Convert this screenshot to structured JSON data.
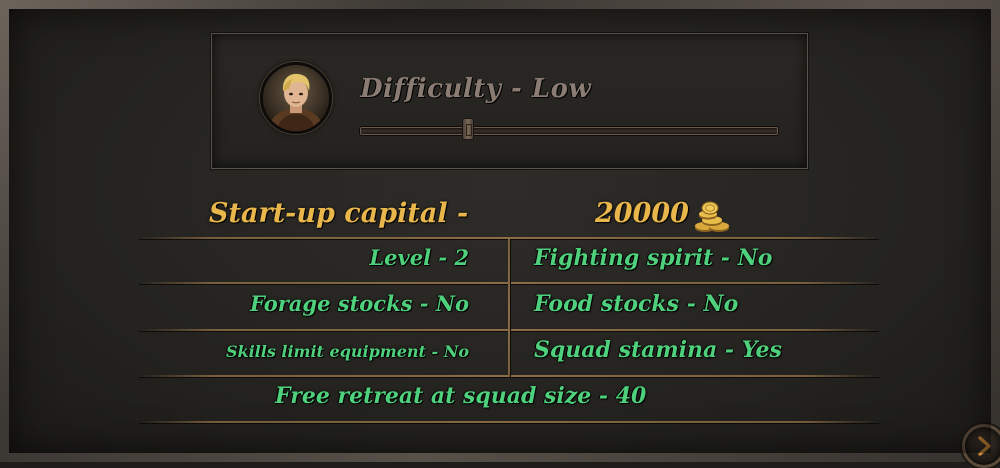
{
  "difficulty": {
    "title": "Difficulty - Low",
    "slider_level": 0.25
  },
  "capital": {
    "label": "Start-up capital -",
    "value": "20000",
    "icon": "gold-coins-icon"
  },
  "stats": {
    "level": "Level - 2",
    "fighting_spirit": "Fighting spirit - No",
    "forage_stocks": "Forage stocks - No",
    "food_stocks": "Food stocks - No",
    "skills_limit": "Skills limit equipment - No",
    "squad_stamina": "Squad stamina - Yes",
    "free_retreat": "Free retreat at squad size - 40"
  },
  "next_button": {
    "icon": "chevron-right-icon"
  },
  "colors": {
    "gold_text": "#e8b64a",
    "green_text": "#4fd07c",
    "muted_title": "#8a7c72"
  }
}
